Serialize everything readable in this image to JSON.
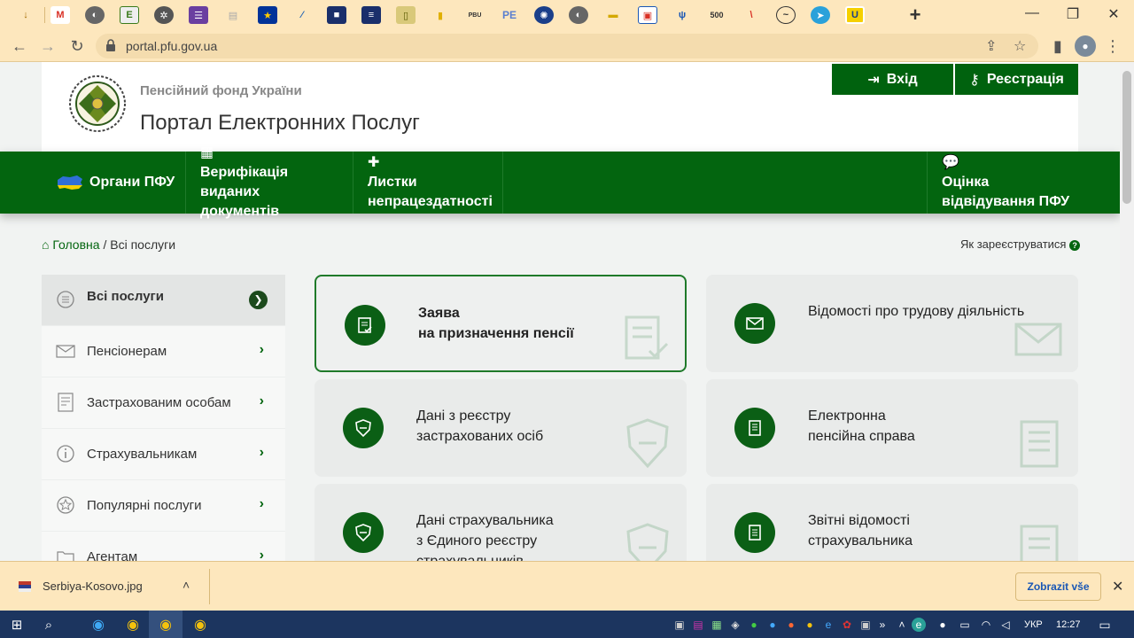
{
  "browser": {
    "url": "portal.pfu.gov.ua",
    "tab_icon_labels": [
      "E",
      "РВU",
      "PE",
      "500"
    ]
  },
  "header": {
    "org_name": "Пенсійний фонд України",
    "portal_title": "Портал Електронних Послуг",
    "login_label": "Вхід",
    "register_label": "Реєстрація"
  },
  "topnav": {
    "items": [
      {
        "label": "Органи ПФУ",
        "icon": "ukraine-map-icon"
      },
      {
        "label": "Верифікація виданих документів",
        "icon": "qr-code-icon"
      },
      {
        "label": "Листки непрацездатності",
        "icon": "medkit-icon"
      },
      {
        "label": "Оцінка відвідування ПФУ",
        "icon": "comment-icon"
      }
    ]
  },
  "breadcrumb": {
    "home": "Головна",
    "separator": "/",
    "current": "Всі послуги"
  },
  "how_to_register": "Як зареєструватися",
  "sidebar": {
    "items": [
      {
        "label": "Всі послуги",
        "icon": "list-icon",
        "active": true
      },
      {
        "label": "Пенсіонерам",
        "icon": "envelope-icon"
      },
      {
        "label": "Застрахованим особам",
        "icon": "document-icon"
      },
      {
        "label": "Страхувальникам",
        "icon": "info-icon"
      },
      {
        "label": "Популярні послуги",
        "icon": "star-icon"
      },
      {
        "label": "Агентам",
        "icon": "folder-icon"
      }
    ]
  },
  "cards": [
    {
      "line1": "Заява",
      "line2": "на призначення пенсії",
      "line3": "",
      "icon": "form-check-icon",
      "active": true
    },
    {
      "line1": "Відомості про трудову діяльність",
      "line2": "",
      "line3": "",
      "icon": "envelope-icon"
    },
    {
      "line1": "Дані з реєстру",
      "line2": "застрахованих осіб",
      "line3": "",
      "icon": "shield-icon"
    },
    {
      "line1": "Електронна",
      "line2": "пенсійна справа",
      "line3": "",
      "icon": "file-icon"
    },
    {
      "line1": "Дані страхувальника",
      "line2": "з Єдиного реєстру",
      "line3": "страхувальників",
      "icon": "shield-icon"
    },
    {
      "line1": "Звітні відомості",
      "line2": "страхувальника",
      "line3": "",
      "icon": "report-icon"
    }
  ],
  "download": {
    "file_name": "Serbiya-Kosovo.jpg",
    "show_all": "Zobrazit vše"
  },
  "taskbar": {
    "language": "УКР",
    "time": "12:27"
  },
  "colors": {
    "brand_green": "#03650f",
    "browser_bar": "#fde7bd",
    "taskbar": "#1c355f"
  }
}
